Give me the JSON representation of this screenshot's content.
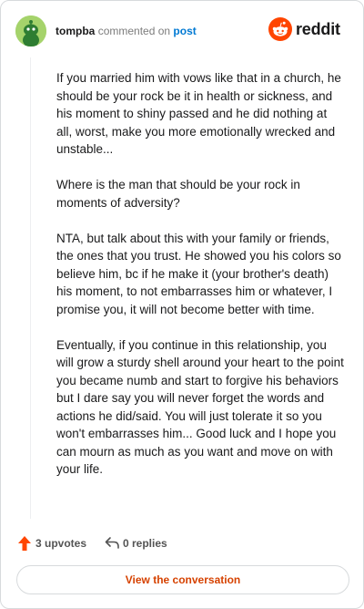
{
  "header": {
    "username": "tompba",
    "verb": "commented on",
    "link_text": "post",
    "brand": "reddit"
  },
  "comment": {
    "paragraphs": [
      "If you married him with vows like that in a church, he should be your rock be it in health or sickness, and his moment to shiny passed and he did nothing at all, worst, make you more emotionally wrecked and unstable...",
      "Where is the man that should be your rock in moments of adversity?",
      "NTA, but talk about this with your family or friends, the ones that you trust. He showed you his colors so believe him, bc if he make it (your brother's death) his moment, to not embarrasses him or whatever, I promise you, it will not become better with time.",
      "Eventually, if you continue in this relationship, you will grow a sturdy shell around your heart to the point you became numb and start to forgive his behaviors but I dare say you will never forget the words and actions he did/said. You will just tolerate it so you won't embarrasses him... Good luck and I hope you can mourn as much as you want and move on with your life."
    ]
  },
  "actions": {
    "upvotes_label": "3 upvotes",
    "replies_label": "0 replies"
  },
  "cta": {
    "label": "View the conversation"
  },
  "colors": {
    "brand_orange": "#ff4500",
    "link_blue": "#0079d3",
    "cta_text": "#d64200",
    "avatar_green": "#a5d36b"
  }
}
